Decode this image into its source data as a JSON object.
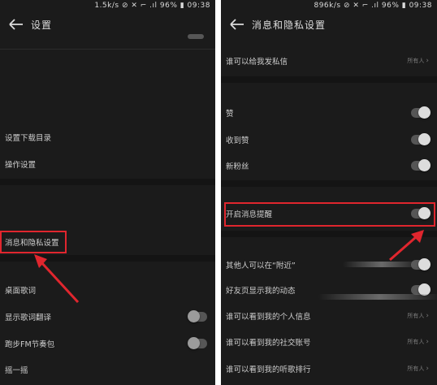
{
  "left": {
    "status": "1.5k/s ⊘ ✕ ⌐ .ıl 96% ▮ 09:38",
    "title": "设置",
    "rows": [
      {
        "label": "设置下载目录"
      },
      {
        "label": "操作设置"
      },
      {
        "label": "消息和隐私设置"
      },
      {
        "label": "桌面歌词"
      },
      {
        "label": "显示歌词翻译"
      },
      {
        "label": "跑步FM节奏包"
      },
      {
        "label": "摇一摇"
      }
    ]
  },
  "right": {
    "status": "896k/s ⊘ ✕ ⌐ .ıl 96% ▮ 09:38",
    "title": "消息和隐私设置",
    "rows": [
      {
        "label": "谁可以给我发私信",
        "value": "所有人"
      },
      {
        "label": "赞"
      },
      {
        "label": "收到赞"
      },
      {
        "label": "新粉丝"
      },
      {
        "label": "开启消息提醒"
      },
      {
        "label": "其他人可以在“附近”"
      },
      {
        "label": "好友页显示我的动态"
      },
      {
        "label": "谁可以看到我的个人信息",
        "value": "所有人"
      },
      {
        "label": "谁可以看到我的社交账号",
        "value": "所有人"
      },
      {
        "label": "谁可以看到我的听歌排行",
        "value": "所有人"
      }
    ]
  },
  "colors": {
    "background": "#1b1b1b",
    "highlight": "#e0262e",
    "toggle_knob": "#dcdcdc"
  }
}
